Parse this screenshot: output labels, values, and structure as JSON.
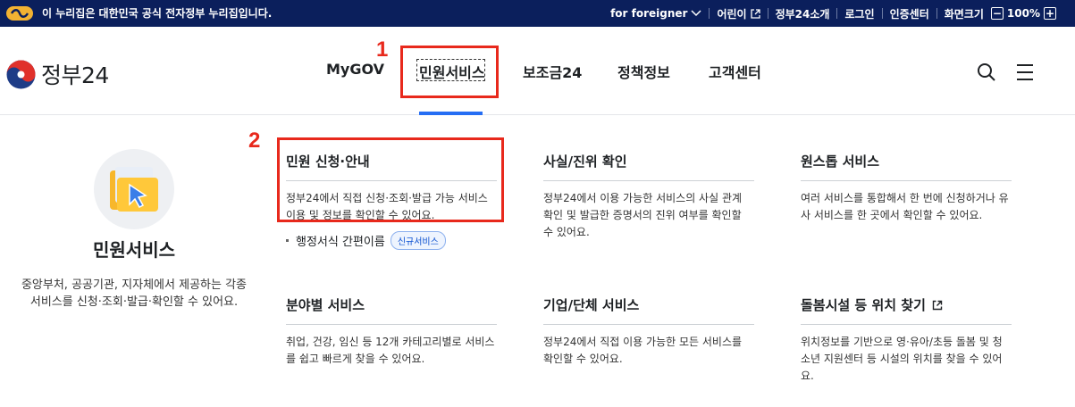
{
  "topbar": {
    "gov_notice": "이 누리집은 대한민국 공식 전자정부 누리집입니다.",
    "items": {
      "foreigner": "for foreigner",
      "kids": "어린이",
      "intro": "정부24소개",
      "login": "로그인",
      "cert": "인증센터",
      "zoom_label": "화면크기",
      "zoom_value": "100%",
      "zoom_minus": "−",
      "zoom_plus": "+"
    }
  },
  "header": {
    "logo_text": "정부24",
    "nav": {
      "mygov": "MyGOV",
      "civil": "민원서비스",
      "subsidy": "보조금24",
      "policy": "정책정보",
      "support": "고객센터"
    }
  },
  "annotations": {
    "one": "1",
    "two": "2"
  },
  "intro": {
    "title": "민원서비스",
    "description": "중앙부처, 공공기관, 지자체에서 제공하는 각종 서비스를 신청·조회·발급·확인할 수 있어요."
  },
  "cards": {
    "apply": {
      "title": "민원 신청·안내",
      "desc": "정부24에서 직접 신청·조회·발급 가능 서비스 이용 및 정보를 확인할 수 있어요."
    },
    "fact": {
      "title": "사실/진위 확인",
      "desc": "정부24에서 이용 가능한 서비스의 사실 관계 확인 및 발급한 증명서의 진위 여부를 확인할 수 있어요."
    },
    "onestop": {
      "title": "원스톱 서비스",
      "desc": "여러 서비스를 통합해서 한 번에 신청하거나 유사 서비스를 한 곳에서 확인할 수 있어요."
    },
    "category": {
      "title": "분야별 서비스",
      "desc": "취업, 건강, 임신 등 12개 카테고리별로 서비스를 쉽고 빠르게 찾을 수 있어요."
    },
    "org": {
      "title": "기업/단체 서비스",
      "desc": "정부24에서 직접 이용 가능한 모든 서비스를 확인할 수 있어요."
    },
    "care": {
      "title": "돌봄시설 등 위치 찾기",
      "desc": "위치정보를 기반으로 영·유아/초등 돌봄 및 청소년 지원센터 등 시설의 위치를 찾을 수 있어요."
    }
  },
  "sub_link": {
    "label": "행정서식 간편이름",
    "badge": "신규서비스"
  },
  "colors": {
    "topbar": "#0b1f5c",
    "accent": "#256ef4",
    "annotation": "#e8291c"
  },
  "icons": [
    "gov-badge-icon",
    "external-link-icon",
    "chevron-down-icon",
    "search-icon",
    "menu-icon",
    "folder-cursor-icon"
  ]
}
